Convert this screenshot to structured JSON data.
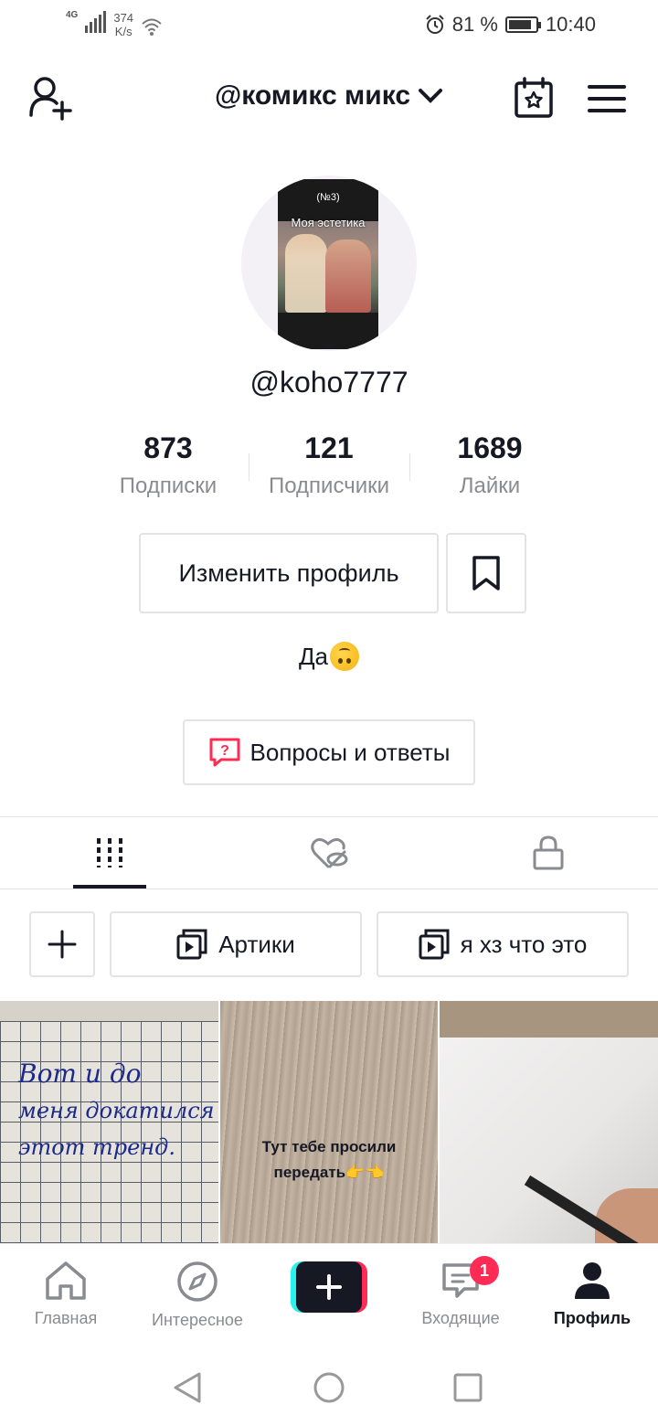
{
  "status_bar": {
    "network": "4G",
    "speed": "374",
    "speed_unit": "K/s",
    "battery": "81 %",
    "time": "10:40"
  },
  "header": {
    "account_name": "@комикс микс",
    "icons": [
      "add-user-icon",
      "chevron-down-icon",
      "calendar-star-icon",
      "menu-icon"
    ]
  },
  "profile": {
    "avatar": {
      "tag": "(№3)",
      "caption": "Моя эстетика"
    },
    "handle": "@koho7777",
    "stats": [
      {
        "value": "873",
        "label": "Подписки"
      },
      {
        "value": "121",
        "label": "Подписчики"
      },
      {
        "value": "1689",
        "label": "Лайки"
      }
    ],
    "edit_button": "Изменить профиль",
    "bio": "Да",
    "qa_button": "Вопросы и ответы"
  },
  "content_tabs": [
    "grid-icon",
    "liked-hidden-icon",
    "lock-icon"
  ],
  "playlists": [
    {
      "label": "Артики"
    },
    {
      "label": "я хз что это"
    }
  ],
  "videos": [
    {
      "text_lines": [
        "Вот и до",
        "меня докатился",
        "этот тренд."
      ]
    },
    {
      "text_lines": [
        "Тут тебе просили",
        "передать👉👈"
      ]
    },
    {
      "text_lines": []
    }
  ],
  "bottom_nav": [
    {
      "label": "Главная"
    },
    {
      "label": "Интересное"
    },
    {
      "label": ""
    },
    {
      "label": "Входящие",
      "badge": "1"
    },
    {
      "label": "Профиль"
    }
  ],
  "colors": {
    "accent": "#fe2c55",
    "cyan": "#25f4ee",
    "text": "#161823",
    "muted": "#8a8b91"
  }
}
